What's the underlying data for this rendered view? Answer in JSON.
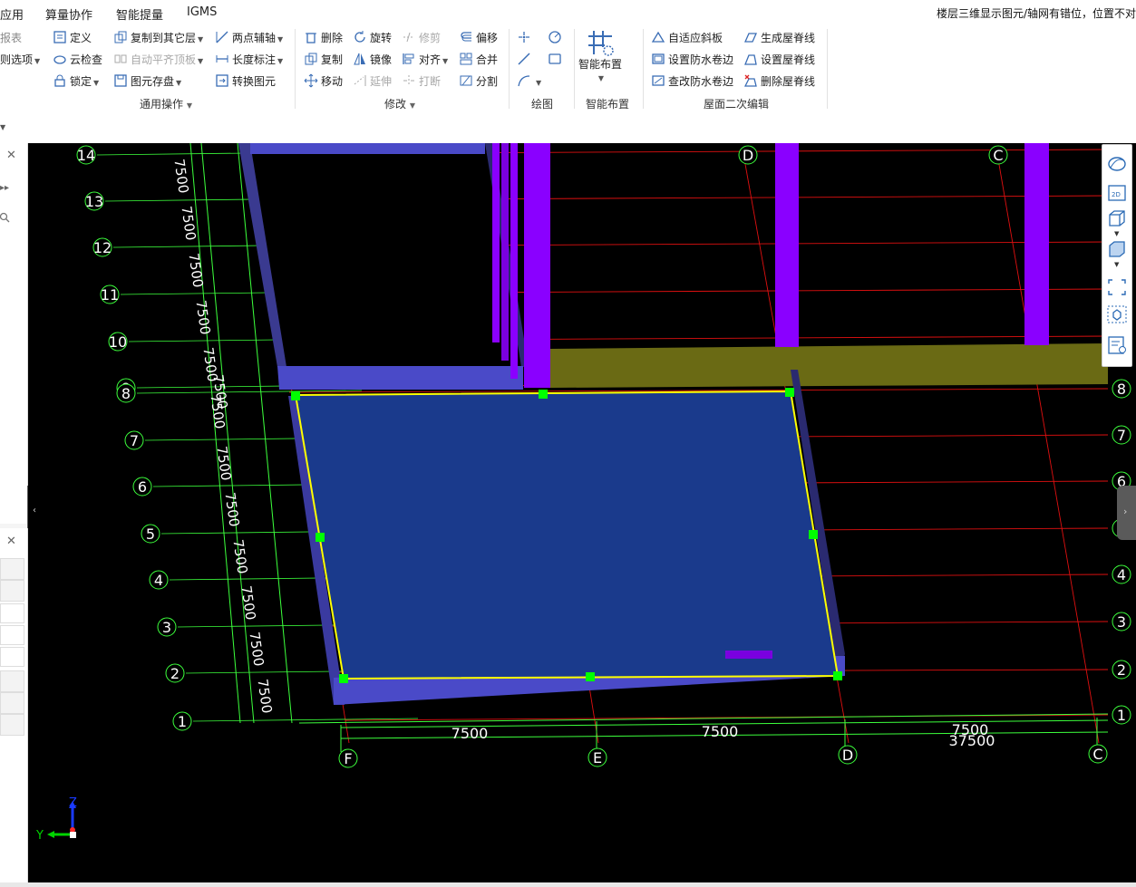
{
  "menu": {
    "items": [
      "应用",
      "算量协作",
      "智能提量",
      "IGMS"
    ],
    "notice": "楼层三维显示图元/轴网有错位，位置不对"
  },
  "ribbon": {
    "left_partial": [
      "报表",
      "则选项"
    ],
    "common_ops": {
      "define": "定义",
      "copy_to_floor": "复制到其它层",
      "two_point_axis": "两点辅轴",
      "cloud_check": "云检查",
      "auto_align_slab": "自动平齐顶板",
      "length_dim": "长度标注",
      "lock": "锁定",
      "element_save": "图元存盘",
      "convert_element": "转换图元",
      "group_label": "通用操作"
    },
    "modify": {
      "delete": "删除",
      "rotate": "旋转",
      "trim": "修剪",
      "offset": "偏移",
      "copy": "复制",
      "mirror": "镜像",
      "align": "对齐",
      "merge": "合并",
      "move": "移动",
      "extend": "延伸",
      "break": "打断",
      "split": "分割",
      "group_label": "修改"
    },
    "draw": {
      "group_label": "绘图"
    },
    "smart": {
      "button": "智能布置",
      "group_label": "智能布置"
    },
    "roof": {
      "adaptive_slope": "自适应斜板",
      "gen_ridge": "生成屋脊线",
      "set_waterproof": "设置防水卷边",
      "set_ridge": "设置屋脊线",
      "check_waterproof": "查改防水卷边",
      "delete_ridge": "删除屋脊线",
      "group_label": "屋面二次编辑"
    }
  },
  "viewport": {
    "background": "#000000",
    "left_axes": [
      "14",
      "13",
      "12",
      "11",
      "10",
      "9",
      "8",
      "7",
      "6",
      "5",
      "4",
      "3",
      "2",
      "1"
    ],
    "right_axes": [
      "8",
      "7",
      "6",
      "5",
      "4",
      "3",
      "2",
      "1"
    ],
    "bottom_axes": [
      "F",
      "E",
      "D",
      "C"
    ],
    "top_axes": [
      "D",
      "C"
    ],
    "left_dims": [
      "7500",
      "7500",
      "7500",
      "7500",
      "7500",
      "7500",
      "7500",
      "7500",
      "7500",
      "7500",
      "7500",
      "7500",
      "7500"
    ],
    "bottom_dims": [
      "7500",
      "7500",
      "7500"
    ],
    "bottom_total": "37500",
    "gizmo": {
      "z": "Z",
      "y": "Y"
    },
    "colors": {
      "axis_green": "#3cff3c",
      "grid_red": "#e01010",
      "slab_fill": "#1a3a8c",
      "slab_edge": "#4a4ac8",
      "column_purple": "#8a00ff",
      "beam_olive": "#6a6a14",
      "selection_yellow": "#ffff00",
      "grip_green": "#00ff00"
    }
  }
}
